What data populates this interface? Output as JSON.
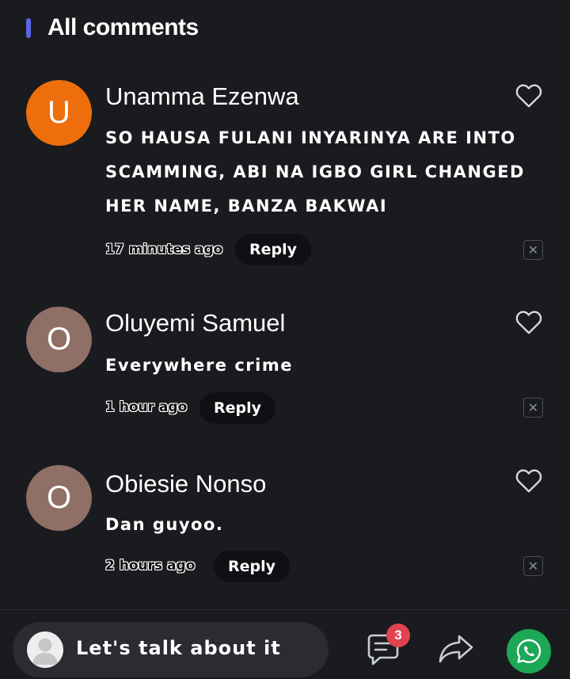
{
  "header": {
    "title": "All comments",
    "accent_color": "#5b66e8"
  },
  "comments": [
    {
      "avatar_letter": "U",
      "avatar_color": "#ee6e0e",
      "author": "Unamma Ezenwa",
      "body": "SO HAUSA FULANI INYARINYA ARE INTO SCAMMING, ABI NA IGBO GIRL CHANGED HER NAME, BANZA BAKWAI",
      "time": "17 minutes ago",
      "reply_label": "Reply"
    },
    {
      "avatar_letter": "O",
      "avatar_color": "#8f6f66",
      "author": "Oluyemi Samuel",
      "body": "Everywhere crime",
      "time": "1 hour ago",
      "reply_label": "Reply"
    },
    {
      "avatar_letter": "O",
      "avatar_color": "#8f6f66",
      "author": "Obiesie Nonso",
      "body": "Dan guyoo.",
      "time": "2 hours ago",
      "reply_label": "Reply"
    }
  ],
  "footer": {
    "input_placeholder": "Let's talk about it",
    "comment_count_badge": "3",
    "icons": {
      "comments": "comments-icon",
      "share": "share-icon",
      "whatsapp": "whatsapp-icon"
    },
    "whatsapp_color": "#1ca855",
    "badge_color": "#e0424f"
  }
}
